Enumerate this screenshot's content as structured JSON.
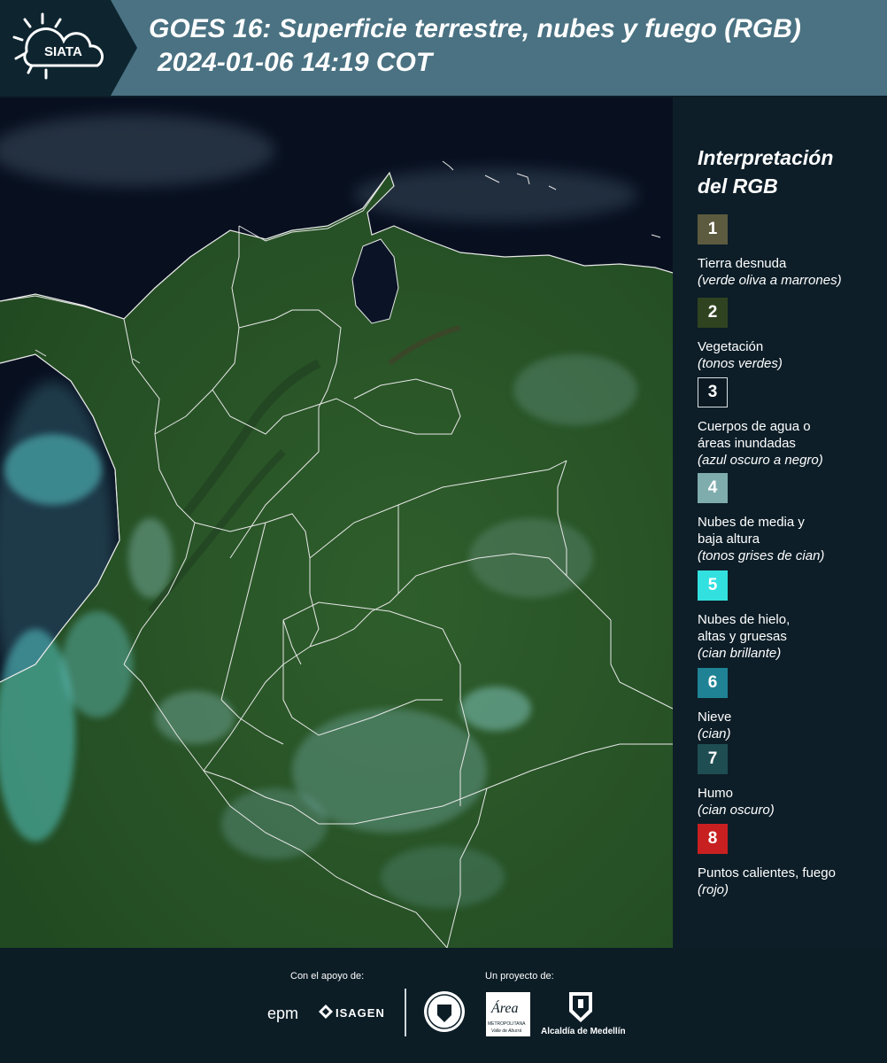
{
  "header": {
    "logo_text": "SIATA",
    "title_line1": "GOES 16: Superficie terrestre, nubes y fuego (RGB)",
    "title_line2": "2024-01-06 14:19 COT"
  },
  "legend": {
    "title_line1": "Interpretación",
    "title_line2": "del RGB",
    "items": [
      {
        "number": "1",
        "color": "#5d5b3f",
        "lines": [
          "Tierra desnuda"
        ],
        "note": "(verde oliva a marrones)"
      },
      {
        "number": "2",
        "color": "#2f4320",
        "lines": [
          "Vegetación"
        ],
        "note": "(tonos verdes)"
      },
      {
        "number": "3",
        "color": "#0b1a22",
        "lines": [
          "Cuerpos de agua o",
          "áreas inundadas"
        ],
        "note": "(azul oscuro a negro)"
      },
      {
        "number": "4",
        "color": "#7fadad",
        "lines": [
          "Nubes de media y",
          "baja altura"
        ],
        "note": "(tonos grises de cian)"
      },
      {
        "number": "5",
        "color": "#33e0e0",
        "lines": [
          "Nubes de hielo,",
          "altas y gruesas"
        ],
        "note": "(cian brillante)"
      },
      {
        "number": "6",
        "color": "#1f8395",
        "lines": [
          "Nieve"
        ],
        "note": "(cian)"
      },
      {
        "number": "7",
        "color": "#1e4d52",
        "lines": [
          "Humo"
        ],
        "note": "(cian oscuro)"
      },
      {
        "number": "8",
        "color": "#c82020",
        "lines": [
          "Puntos calientes, fuego"
        ],
        "note": "(rojo)"
      }
    ]
  },
  "footer": {
    "support_label": "Con el apoyo de:",
    "project_label": "Un proyecto de:",
    "logos": {
      "epm": "epm",
      "isagen": "ISAGEN",
      "area_line1": "Área",
      "area_line2": "METROPOLITANA",
      "area_line3": "Valle de Aburrá",
      "alcaldia": "Alcaldía de Medellín"
    }
  },
  "colors": {
    "header_bg": "#4a7282",
    "page_bg": "#0c1d26",
    "map_land": "#2c5a2c",
    "map_ocean": "#0a1020",
    "boundary": "#e8e8e8"
  }
}
